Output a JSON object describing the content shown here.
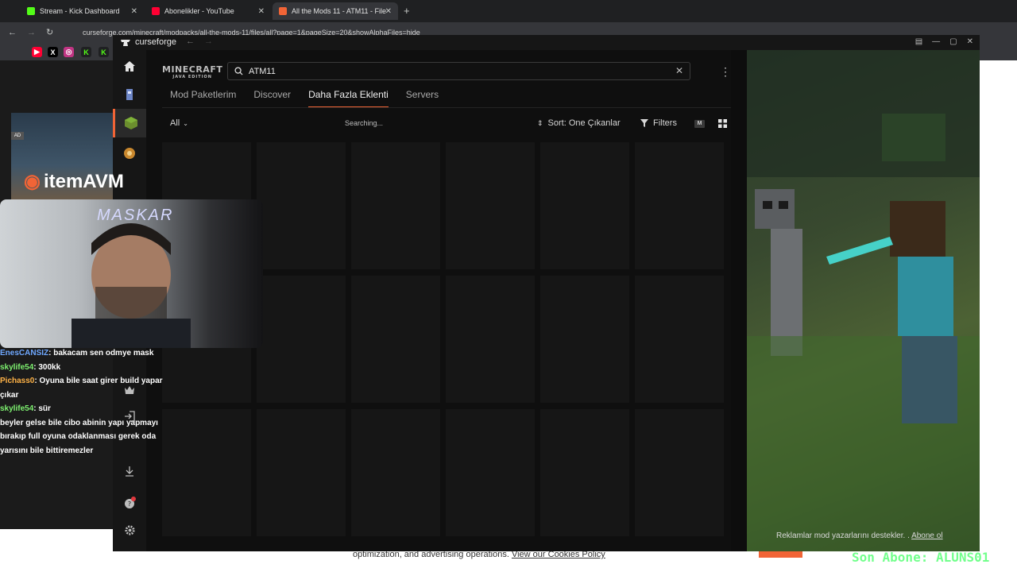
{
  "browser": {
    "tabs": [
      {
        "label": "Stream - Kick Dashboard",
        "icon": "kick-icon"
      },
      {
        "label": "Abonelikler - YouTube",
        "icon": "youtube-icon"
      },
      {
        "label": "All the Mods 11 - ATM11 - File",
        "icon": "curseforge-icon"
      }
    ],
    "url": "curseforge.com/minecraft/modpacks/all-the-mods-11/files/all?page=1&pageSize=20&showAlphaFiles=hide"
  },
  "curseforge": {
    "app_name": "curseforge",
    "game_logo": "MINECRAFT",
    "game_logo_sub": "JAVA EDITION",
    "search_value": "ATM11",
    "tabs": [
      "Mod Paketlerim",
      "Discover",
      "Daha Fazla Eklenti",
      "Servers"
    ],
    "active_tab": "Daha Fazla Eklenti",
    "filter_all": "All",
    "status": "Searching...",
    "sort_label": "Sort: One Çıkanlar",
    "filters_label": "Filters",
    "view_m": "M",
    "card_count": 18,
    "ad_footer": "Reklamlar mod yazarlarını destekler. .",
    "ad_footer_link": "Abone ol",
    "accent": "#f16436"
  },
  "webpage": {
    "cookie_text": "optimization, and advertising operations.",
    "cookie_link": "View our Cookies Policy"
  },
  "stream_overlay": {
    "ad_badge": "AD",
    "brand": "itemAVM",
    "webcam_name": "MASKAR",
    "chat": [
      {
        "user": "EnesCANSIZ",
        "msg": ": bakacam sen odmye mask"
      },
      {
        "user": "skylife54",
        "msg": ": 300kk"
      },
      {
        "user": "Pichass0",
        "msg": ": Oyuna bile saat girer build yapar çıkar"
      },
      {
        "user": "skylife54",
        "msg": ": sür"
      },
      {
        "user": "",
        "msg": "beyler gelse bile cibo abinin yapı yapmayı bırakıp full oyuna odaklanması gerek oda yarısını bile bittiremezler"
      }
    ],
    "sub_banner": "Son Abone: ALUNS01"
  }
}
